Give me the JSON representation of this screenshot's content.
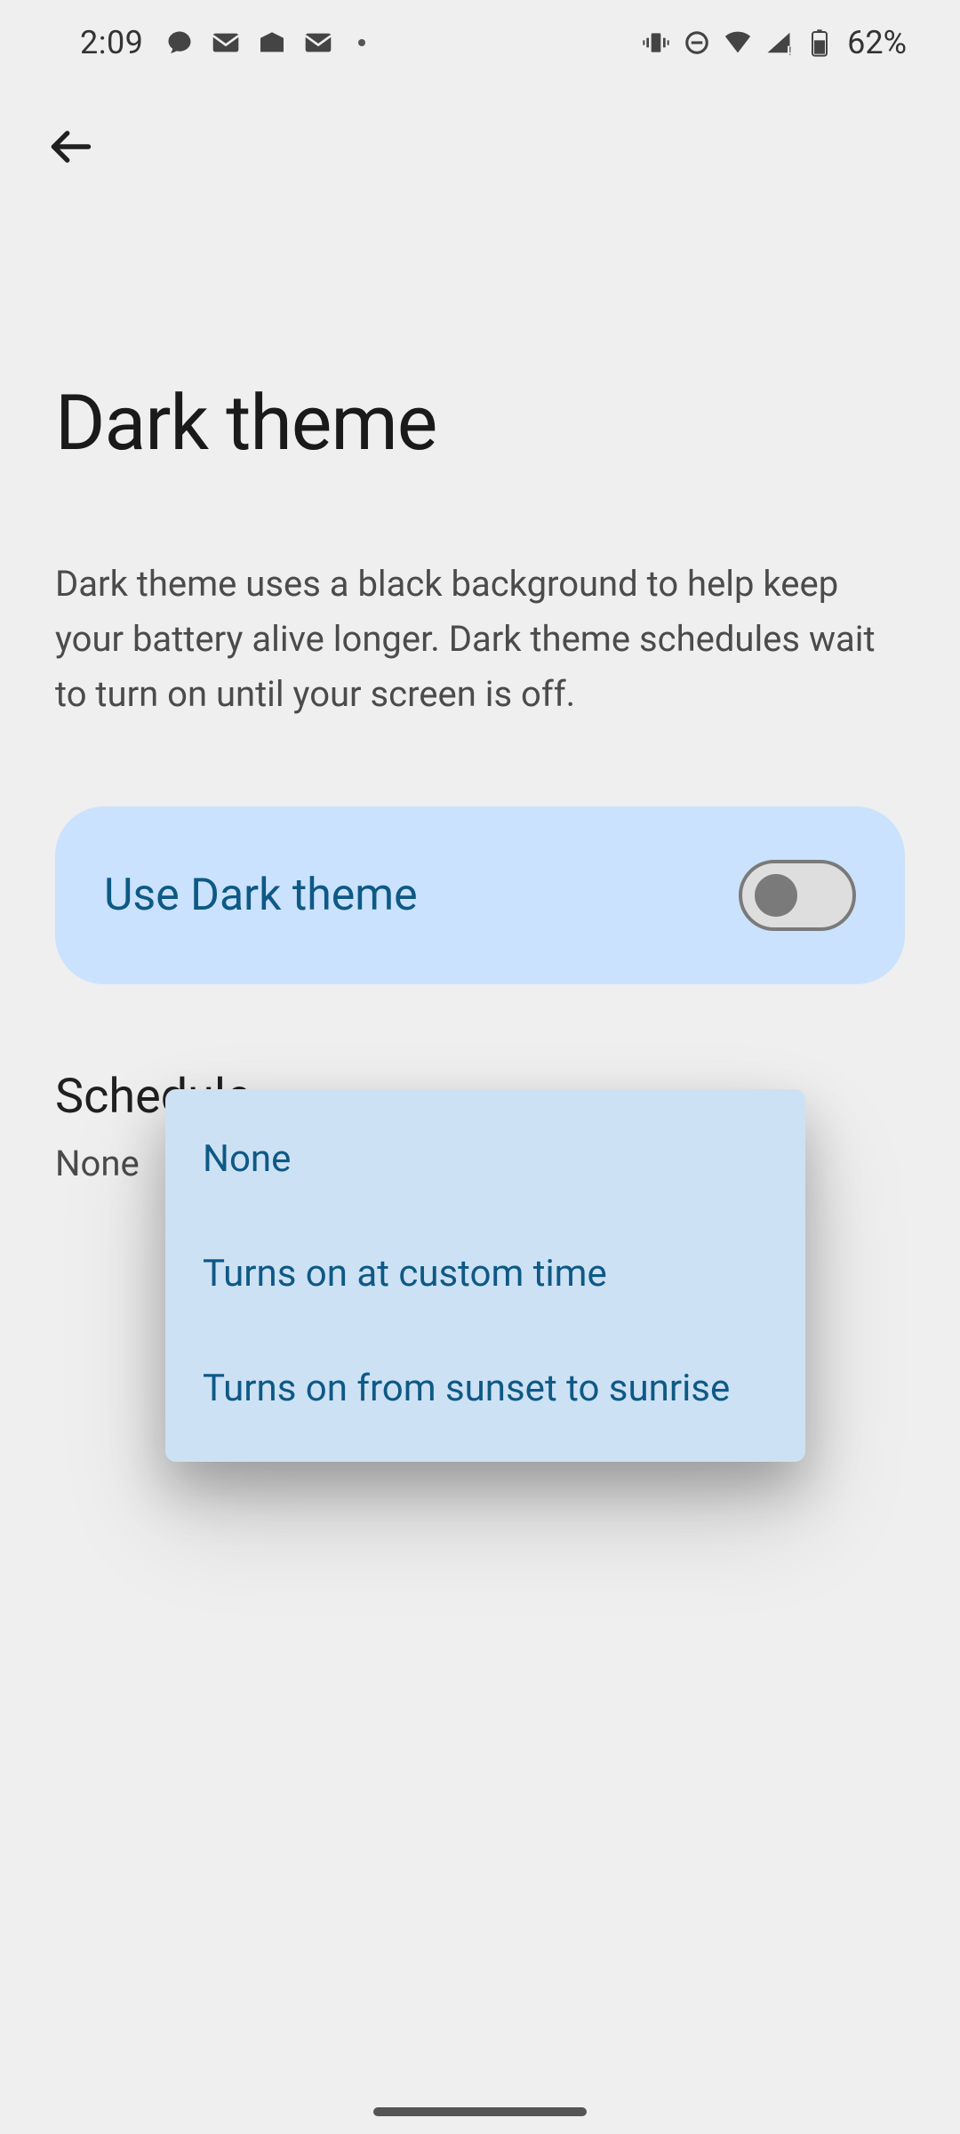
{
  "status": {
    "time": "2:09",
    "battery": "62%"
  },
  "page": {
    "title": "Dark theme",
    "description": "Dark theme uses a black background to help keep your battery alive longer. Dark theme schedules wait to turn on until your screen is off."
  },
  "toggle": {
    "label": "Use Dark theme",
    "on": false
  },
  "schedule": {
    "title": "Schedule",
    "value": "None",
    "options": [
      "None",
      "Turns on at custom time",
      "Turns on from sunset to sunrise"
    ]
  }
}
